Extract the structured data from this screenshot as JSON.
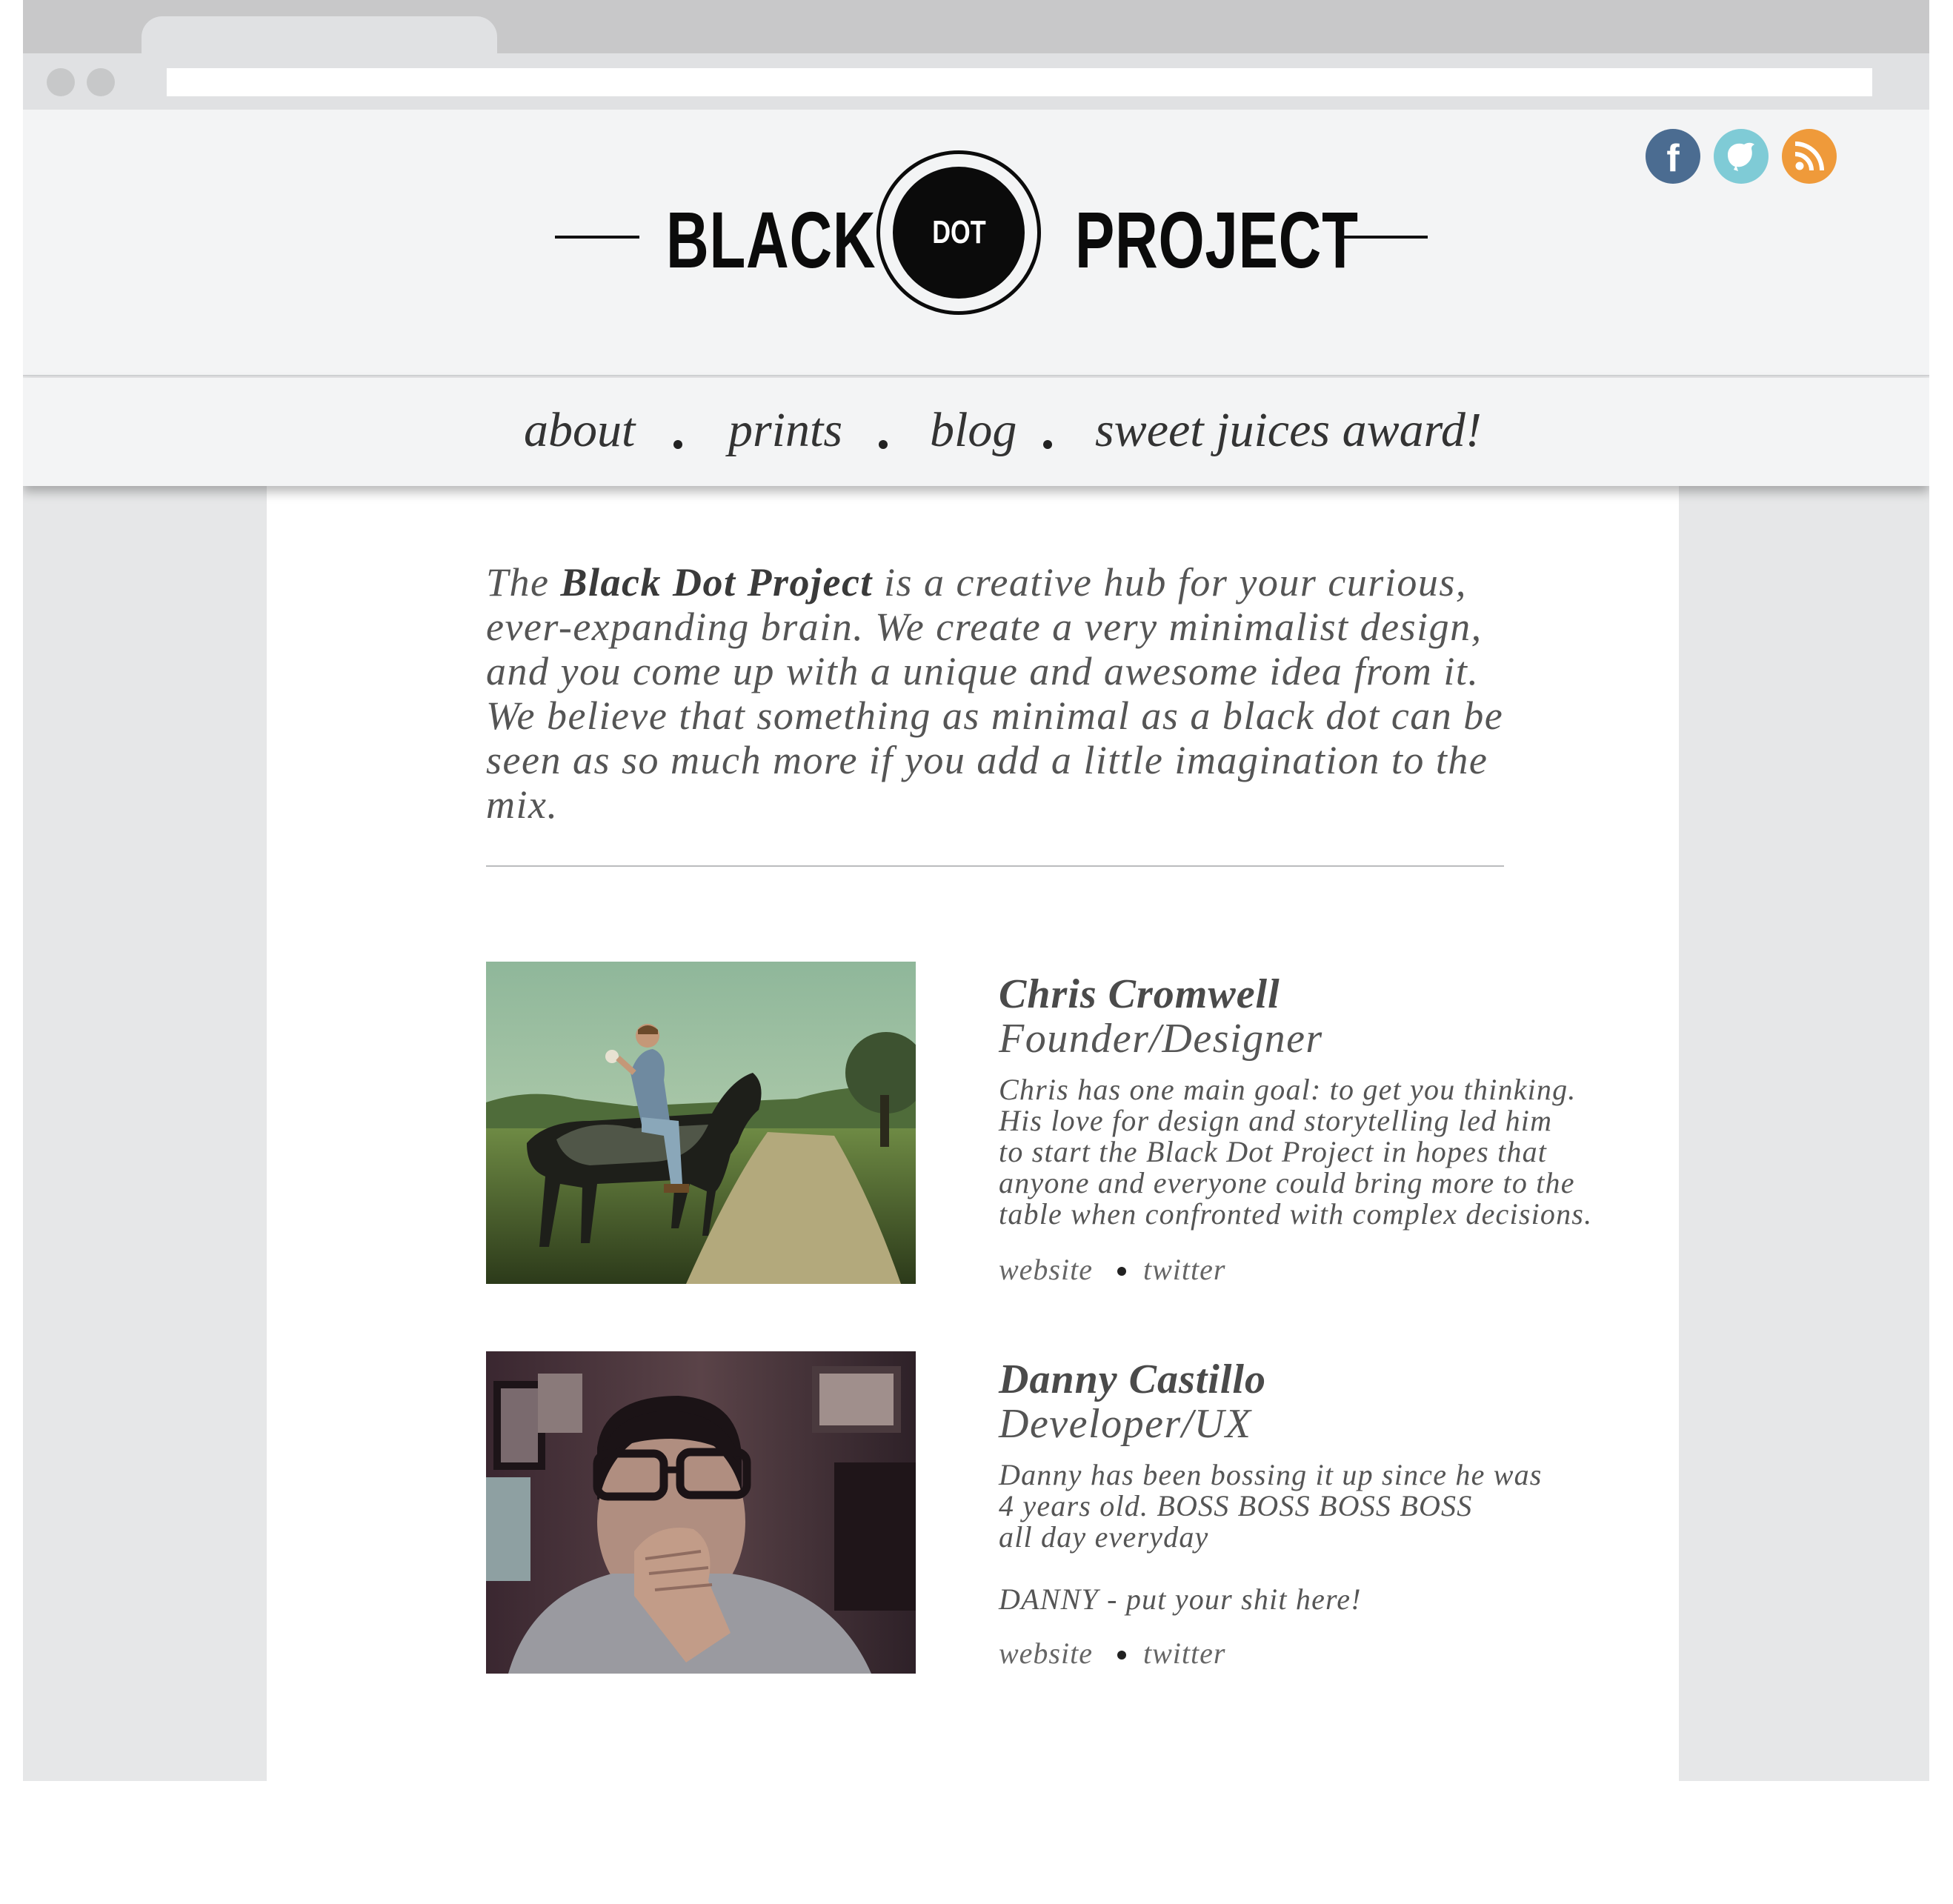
{
  "site": {
    "logo": {
      "left_word": "BLACK",
      "center_word": "DOT",
      "right_word": "PROJECT"
    },
    "social": [
      {
        "name": "facebook",
        "glyph": "f",
        "color": "#4b6c91"
      },
      {
        "name": "twitter",
        "glyph": "bird",
        "color": "#7fcbd6"
      },
      {
        "name": "rss",
        "glyph": "rss",
        "color": "#ef9a3a"
      }
    ],
    "nav": [
      "about",
      "prints",
      "blog",
      "sweet juices award!"
    ]
  },
  "intro": {
    "part1": "The ",
    "brand": "Black Dot Project",
    "part2": " is a creative hub for your curious, ever-expanding brain. We create a very minimalist design, and you come up with a unique and awesome idea from it. We believe that something as minimal as a black dot can be seen as so much more if you add a little imagination to the mix."
  },
  "team": [
    {
      "name": "Chris Cromwell",
      "role": "Founder/Designer",
      "bio": "Chris has one main goal: to get you thinking.\nHis love for design and storytelling led him\nto start the Black Dot Project in hopes that\nanyone and everyone could bring more to the\ntable when confronted with complex decisions.",
      "links": [
        "website",
        "twitter"
      ]
    },
    {
      "name": "Danny Castillo",
      "role": "Developer/UX",
      "bio": "Danny has been bossing it up since he was\n4 years old.  BOSS BOSS BOSS BOSS\nall day everyday\n\nDANNY - put your shit here!",
      "links": [
        "website",
        "twitter"
      ]
    }
  ]
}
